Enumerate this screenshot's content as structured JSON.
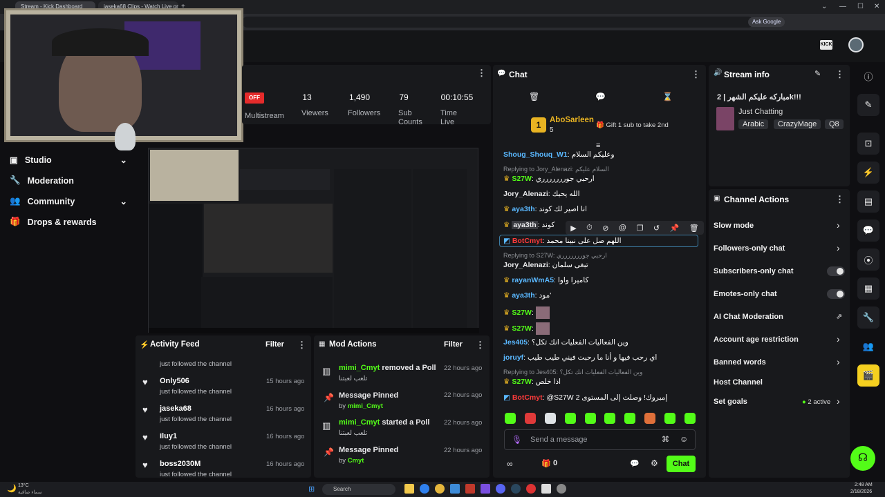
{
  "browser": {
    "tabs": [
      "Stream - Kick Dashboard",
      "jaseka68 Clips - Watch Live on..."
    ],
    "new_tab": "+",
    "ask_google": "Ask Google",
    "window_controls": [
      "⌄",
      "—",
      "☐",
      "✕"
    ]
  },
  "header": {
    "avatar_icon": "avatar",
    "logo": "KICK"
  },
  "nav": {
    "items": [
      {
        "label": "Studio",
        "icon": "studio-icon",
        "expandable": true
      },
      {
        "label": "Moderation",
        "icon": "wrench-icon",
        "expandable": false
      },
      {
        "label": "Community",
        "icon": "community-icon",
        "expandable": true
      },
      {
        "label": "Drops & rewards",
        "icon": "gift-icon",
        "expandable": false
      }
    ]
  },
  "stats": {
    "off_badge": "OFF",
    "multistream": "Multistream",
    "items": [
      {
        "value": "13",
        "label": "Viewers"
      },
      {
        "value": "1,490",
        "label": "Followers"
      },
      {
        "value": "79",
        "label": "Sub Counts"
      },
      {
        "value": "00:10:55",
        "label": "Time Live"
      }
    ]
  },
  "activity": {
    "title": "Activity Feed",
    "filter": "Filter",
    "partial_top": "just followed the channel",
    "items": [
      {
        "name": "Only506",
        "text": "just followed the channel",
        "time": "15 hours ago"
      },
      {
        "name": "jaseka68",
        "text": "just followed the channel",
        "time": "16 hours ago"
      },
      {
        "name": "iluy1",
        "text": "just followed the channel",
        "time": "16 hours ago"
      },
      {
        "name": "boss2030M",
        "text": "just followed the channel",
        "time": "16 hours ago"
      }
    ]
  },
  "mod_actions": {
    "title": "Mod Actions",
    "filter": "Filter",
    "items": [
      {
        "user": "mimi_Cmyt",
        "action": "removed a Poll",
        "sub": "تلعب لعبتنا",
        "time": "22 hours ago",
        "icon": "poll-icon"
      },
      {
        "user": "",
        "action": "Message Pinned",
        "by_label": "by",
        "by": "mimi_Cmyt",
        "time": "22 hours ago",
        "icon": "pin-icon"
      },
      {
        "user": "mimi_Cmyt",
        "action": "started a Poll",
        "sub": "تلعب لعبتنا",
        "time": "22 hours ago",
        "icon": "poll-icon"
      },
      {
        "user": "",
        "action": "Message Pinned",
        "by_label": "by",
        "by": "Cmyt",
        "time": "22 hours ago",
        "icon": "pin-icon"
      }
    ]
  },
  "chat": {
    "title": "Chat",
    "top_gifter": {
      "rank": "1",
      "name": "AboSarleen",
      "count": "5",
      "gift_text": "Gift 1 sub to take 2nd"
    },
    "messages": [
      {
        "user": "Shoug_Shouq_W1",
        "text": "وعليكم السلام",
        "color": "blue"
      },
      {
        "reply": "Replying to Jory_Alenazi: السلام عليكم",
        "user": "S27W",
        "text": "ارحبي جوررررررري",
        "color": "green"
      },
      {
        "user": "Jory_Alenazi",
        "text": "الله يحيك",
        "color": "gray"
      },
      {
        "user": "aya3th",
        "text": "انا اصير لك كوند",
        "color": "blue"
      },
      {
        "user": "aya3th",
        "text": "كوند",
        "color": "gray"
      },
      {
        "user": "BotCmyt",
        "text": "اللهم صل على نبينا محمد",
        "color": "red"
      },
      {
        "reply": "Replying to S27W: ارحبي جوررررررري",
        "user": "Jory_Alenazi",
        "text": "تبغى سلمان",
        "color": "gray"
      },
      {
        "user": "rayanWmA5",
        "text": "كاميرا واوا",
        "color": "blue"
      },
      {
        "user": "aya3th",
        "text": "مود'",
        "color": "blue"
      },
      {
        "user": "S27W",
        "text": "",
        "color": "green"
      },
      {
        "user": "S27W",
        "text": "",
        "color": "green"
      },
      {
        "user": "Jes405",
        "text": "وين الفعاليات الفعليات انك تكل؟",
        "color": "blue"
      },
      {
        "user": "joruyf",
        "text": "اي رحب فيها و أنا ما رحبت فيني طيب طيب",
        "color": "blue"
      },
      {
        "reply": "Replying to Jes405: وين الفعاليات الفعليات انك تكل؟",
        "user": "S27W",
        "text": "اذا خلص",
        "color": "green"
      },
      {
        "user": "BotCmyt",
        "text": "@S27W إمبروك! وصلت إلى المستوى 2",
        "color": "red"
      }
    ],
    "send_placeholder": "Send a message",
    "chat_button": "Chat",
    "points": "0"
  },
  "stream_info": {
    "title": "Stream info",
    "stream_title": "مباركه عليكم الشهر | 2k!!!",
    "category": "Just Chatting",
    "tags": [
      "Arabic",
      "CrazyMage",
      "Q8"
    ]
  },
  "channel_actions": {
    "title": "Channel Actions",
    "items": [
      {
        "label": "Slow mode",
        "control": "chevron"
      },
      {
        "label": "Followers-only chat",
        "control": "chevron"
      },
      {
        "label": "Subscribers-only chat",
        "control": "toggle"
      },
      {
        "label": "Emotes-only chat",
        "control": "toggle"
      },
      {
        "label": "AI Chat Moderation",
        "control": "external"
      },
      {
        "label": "Account age restriction",
        "control": "chevron"
      },
      {
        "label": "Banned words",
        "control": "chevron"
      },
      {
        "label": "Host Channel",
        "control": "none"
      },
      {
        "label": "Set goals",
        "control": "chevron",
        "status": "2 active"
      }
    ]
  },
  "taskbar": {
    "weather_temp": "13°C",
    "weather_text": "سماء صافية",
    "search": "Search",
    "time": "2:48 AM",
    "date": "2/18/2026"
  },
  "colors": {
    "accent": "#53fc18",
    "panel": "#18191c",
    "bg": "#0f0f12"
  }
}
